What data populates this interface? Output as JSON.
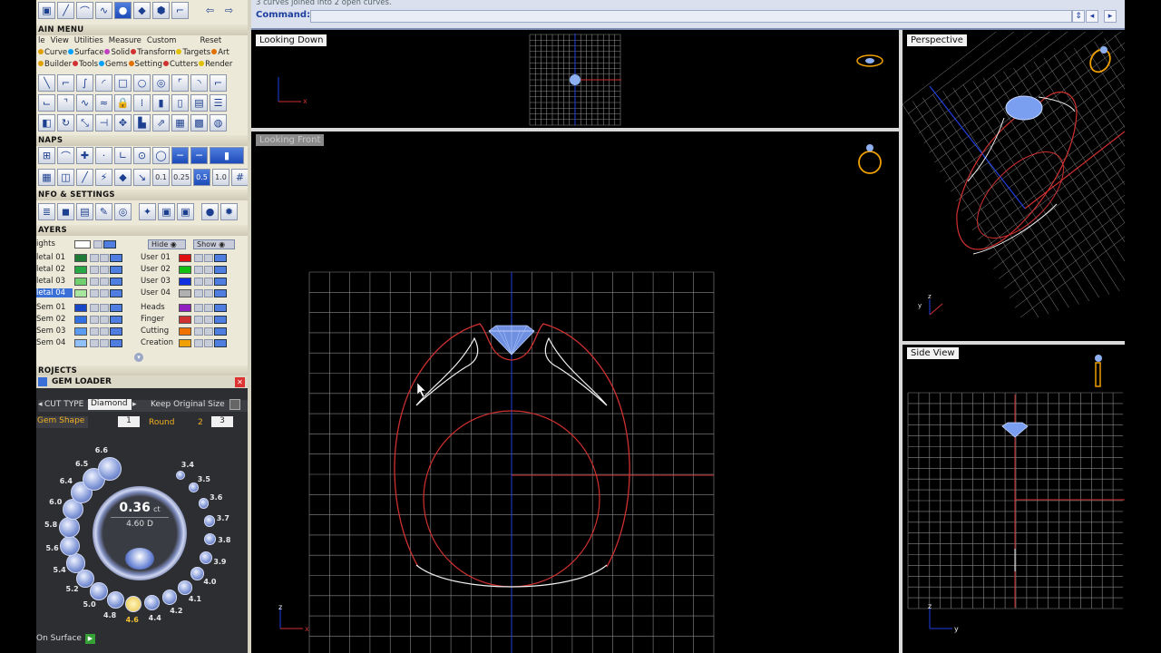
{
  "left_panel": {
    "main_menu_title": "AIN MENU",
    "menu_bar": [
      "le",
      "View",
      "Utilities",
      "Measure",
      "Custom",
      "Reset"
    ],
    "categories_row1": [
      {
        "label": "Curve",
        "color": "#e0a000"
      },
      {
        "label": "Surface",
        "color": "#00a0ff"
      },
      {
        "label": "Solid",
        "color": "#c040c0"
      },
      {
        "label": "Transform",
        "color": "#d03030"
      },
      {
        "label": "Targets",
        "color": "#e0c000"
      },
      {
        "label": "Art",
        "color": "#e07000"
      }
    ],
    "categories_row2": [
      {
        "label": "Builder",
        "color": "#e0a000"
      },
      {
        "label": "Tools",
        "color": "#d03030"
      },
      {
        "label": "Gems",
        "color": "#00a0ff"
      },
      {
        "label": "Setting",
        "color": "#e07000"
      },
      {
        "label": "Cutters",
        "color": "#d03030"
      },
      {
        "label": "Render",
        "color": "#e0c000"
      }
    ],
    "snaps_title": "NAPS",
    "snap_values": [
      "0.1",
      "0.25",
      "0.5",
      "1.0"
    ],
    "info_title": "NFO & SETTINGS",
    "layers_title": "AYERS",
    "lights_label": "ights",
    "hide_label": "Hide",
    "show_label": "Show",
    "layers_left": [
      {
        "label": "letal 01",
        "color": "#1f7a35"
      },
      {
        "label": "letal 02",
        "color": "#28a745"
      },
      {
        "label": "letal 03",
        "color": "#70d070"
      },
      {
        "label": "letal 04",
        "color": "#a8e6a0"
      },
      {
        "label": "Sem 01",
        "color": "#1848c8"
      },
      {
        "label": "Sem 02",
        "color": "#3070e0"
      },
      {
        "label": "Sem 03",
        "color": "#5a9af0"
      },
      {
        "label": "Sem 04",
        "color": "#90c0f8"
      }
    ],
    "layers_right": [
      {
        "label": "User 01",
        "color": "#e01010"
      },
      {
        "label": "User 02",
        "color": "#10c010"
      },
      {
        "label": "User 03",
        "color": "#1030e0"
      },
      {
        "label": "User 04",
        "color": "#b0b0b0"
      },
      {
        "label": "Heads",
        "color": "#9020c0"
      },
      {
        "label": "Finger",
        "color": "#d03030"
      },
      {
        "label": "Cutting",
        "color": "#f07000"
      },
      {
        "label": "Creation",
        "color": "#f0a000"
      }
    ],
    "projects_title": "ROJECTS"
  },
  "gem_loader": {
    "title": "GEM LOADER",
    "cut_type_label": "CUT TYPE",
    "cut_type_value": "Diamond",
    "keep_size_label": "Keep Original Size",
    "gem_shape_label": "Gem Shape",
    "shape_index": "1",
    "shape_name": "Round",
    "page_2": "2",
    "page_3": "3",
    "carat": "0.36",
    "carat_unit": "ct",
    "diameter": "4.60 D",
    "on_surface_label": "On Surface",
    "sizes": [
      "3.4",
      "3.5",
      "3.6",
      "3.7",
      "3.8",
      "3.9",
      "4.0",
      "4.1",
      "4.2",
      "4.4",
      "4.6",
      "4.8",
      "5.0",
      "5.2",
      "5.4",
      "5.6",
      "5.8",
      "6.0",
      "6.4",
      "6.5",
      "6.6"
    ],
    "selected_size": "4.6"
  },
  "top_bar": {
    "message": "3 curves joined into 2 open curves.",
    "command_label": "Command:",
    "command_value": ""
  },
  "viewports": {
    "top": {
      "title": "Looking Down"
    },
    "front": {
      "title": "Looking Front"
    },
    "perspective": {
      "title": "Perspective"
    },
    "side": {
      "title": "Side View"
    }
  },
  "axis_labels": {
    "x": "x",
    "y": "y",
    "z": "z"
  },
  "colors": {
    "grid": "#8a8a8a",
    "curve_red": "#d03030",
    "curve_white": "#f0f0f0",
    "axis_blue": "#2040e0",
    "gem": "#8fb0f0",
    "accent_blue": "#3a6fd8"
  }
}
